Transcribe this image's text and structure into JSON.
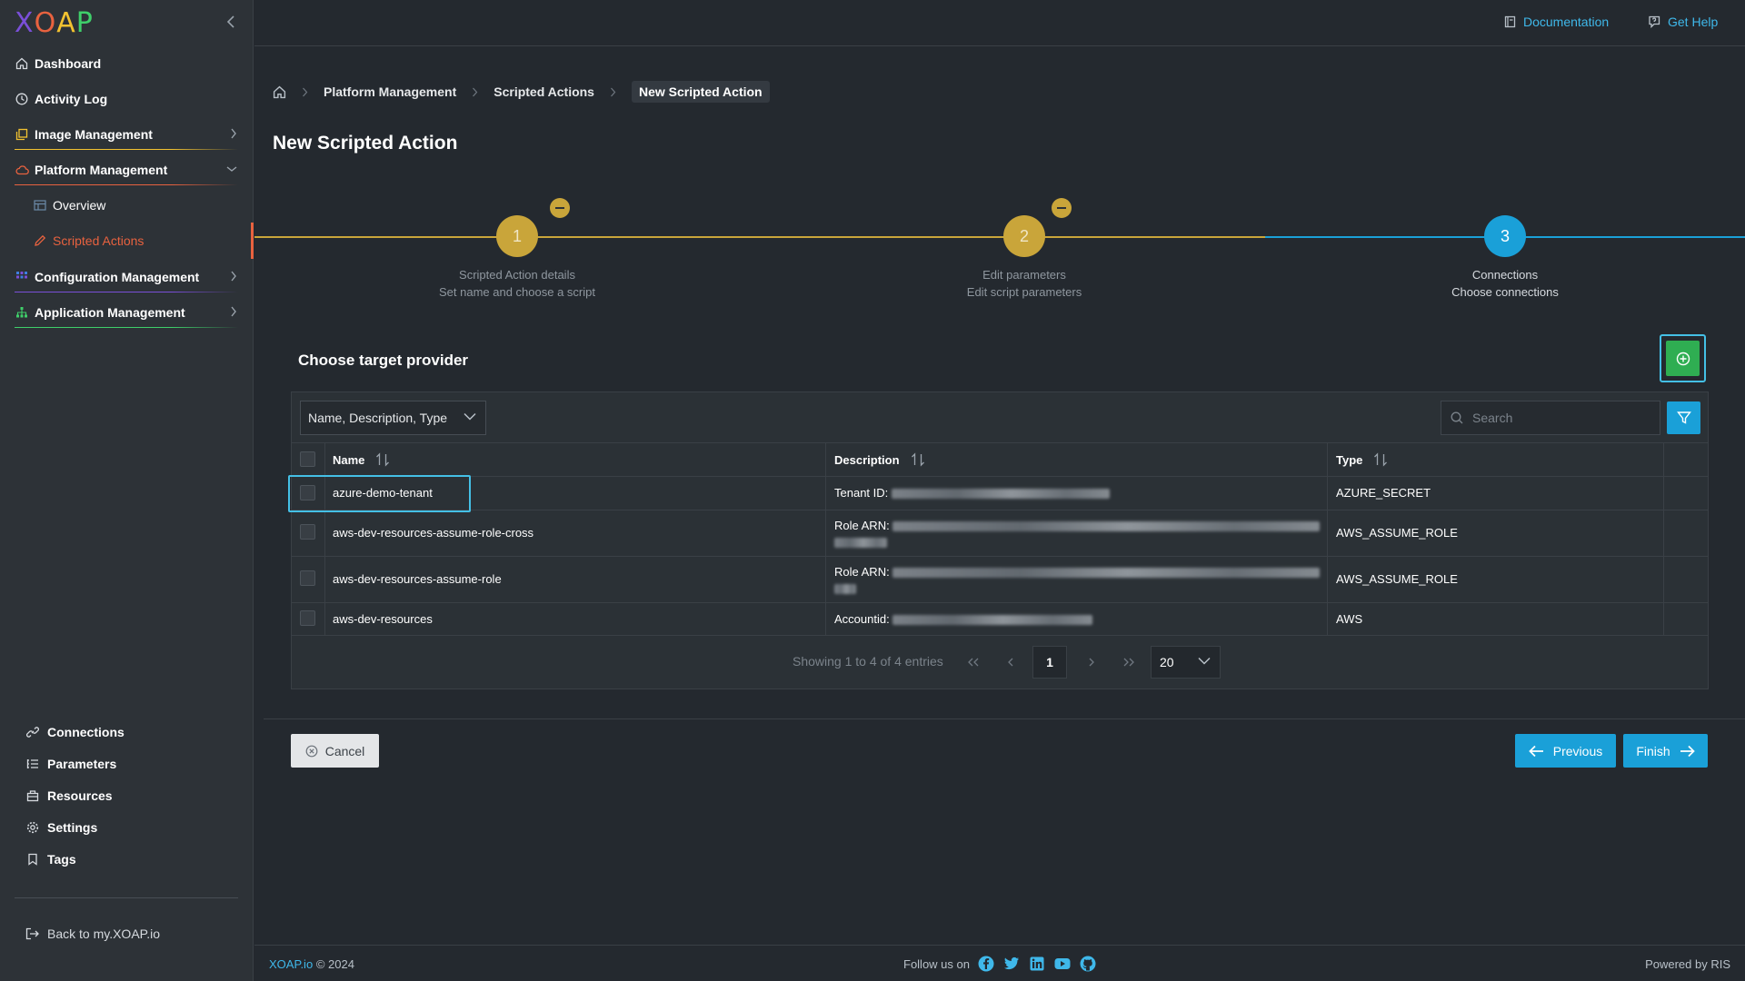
{
  "app": {
    "logo_letters": [
      "X",
      "O",
      "A",
      "P"
    ],
    "logo_colors": [
      "#7a4fd8",
      "#e8623f",
      "#f2c230",
      "#3fcf6a"
    ]
  },
  "sidebar": {
    "items": [
      {
        "label": "Dashboard",
        "icon": "home-icon"
      },
      {
        "label": "Activity Log",
        "icon": "clock-icon"
      },
      {
        "label": "Image Management",
        "icon": "images-icon",
        "underline_color": "#f2c230"
      },
      {
        "label": "Platform Management",
        "icon": "cloud-icon",
        "underline_color": "#e8623f"
      },
      {
        "label": "Overview",
        "icon": "table-icon"
      },
      {
        "label": "Scripted Actions",
        "icon": "pencil-icon"
      },
      {
        "label": "Configuration Management",
        "icon": "grid-icon",
        "underline_color": "#7a4fd8"
      },
      {
        "label": "Application Management",
        "icon": "sitemap-icon",
        "underline_color": "#3fcf6a"
      }
    ],
    "bottom_items": [
      {
        "label": "Connections",
        "icon": "link-icon"
      },
      {
        "label": "Parameters",
        "icon": "list-icon"
      },
      {
        "label": "Resources",
        "icon": "briefcase-icon"
      },
      {
        "label": "Settings",
        "icon": "gear-icon"
      },
      {
        "label": "Tags",
        "icon": "bookmark-icon"
      }
    ],
    "back_label": "Back to my.XOAP.io"
  },
  "topbar": {
    "documentation": "Documentation",
    "get_help": "Get Help"
  },
  "breadcrumb": {
    "items": [
      "Platform Management",
      "Scripted Actions"
    ],
    "current": "New Scripted Action"
  },
  "page": {
    "title": "New Scripted Action"
  },
  "stepper": {
    "steps": [
      {
        "number": "1",
        "title": "Scripted Action details",
        "subtitle": "Set name and choose a script",
        "state": "completed"
      },
      {
        "number": "2",
        "title": "Edit parameters",
        "subtitle": "Edit script parameters",
        "state": "completed"
      },
      {
        "number": "3",
        "title": "Connections",
        "subtitle": "Choose connections",
        "state": "current"
      }
    ],
    "completed_color": "#c9a53a",
    "current_color": "#1aa0d8"
  },
  "provider": {
    "title": "Choose target provider",
    "filter_select": "Name, Description, Type",
    "search_placeholder": "Search",
    "columns": [
      "Name",
      "Description",
      "Type"
    ],
    "rows": [
      {
        "name": "azure-demo-tenant",
        "desc_label": "Tenant ID:",
        "type": "AZURE_SECRET"
      },
      {
        "name": "aws-dev-resources-assume-role-cross",
        "desc_label": "Role ARN:",
        "type": "AWS_ASSUME_ROLE"
      },
      {
        "name": "aws-dev-resources-assume-role",
        "desc_label": "Role ARN:",
        "type": "AWS_ASSUME_ROLE"
      },
      {
        "name": "aws-dev-resources",
        "desc_label": "Accountid:",
        "type": "AWS"
      }
    ],
    "pagination": {
      "info": "Showing 1 to 4 of 4 entries",
      "current_page": "1",
      "page_size": "20"
    }
  },
  "actions": {
    "cancel": "Cancel",
    "previous": "Previous",
    "finish": "Finish"
  },
  "footer": {
    "brand": "XOAP.io",
    "copyright": "© 2024",
    "follow": "Follow us on",
    "powered": "Powered by RIS",
    "social_icons": [
      "facebook-icon",
      "twitter-icon",
      "linkedin-icon",
      "youtube-icon",
      "github-icon"
    ]
  }
}
